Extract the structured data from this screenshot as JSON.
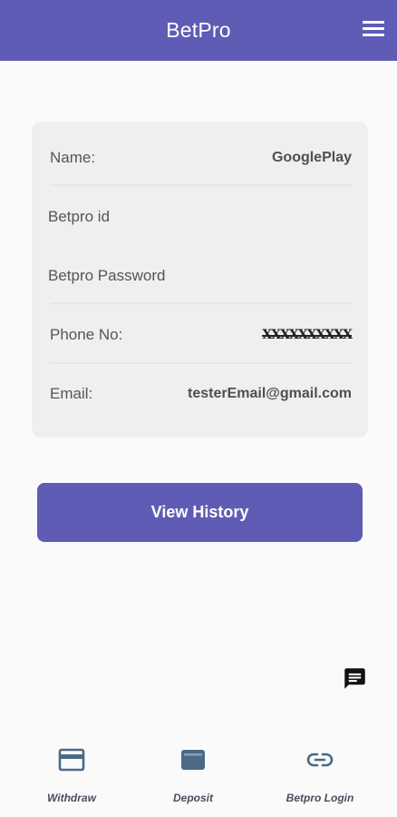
{
  "header": {
    "title": "BetPro",
    "menu_icon": "hamburger-menu-icon"
  },
  "profile": {
    "name_label": "Name:",
    "name_value": "GooglePlay",
    "betpro_id_label": "Betpro id",
    "betpro_password_label": "Betpro Password",
    "phone_label": "Phone No:",
    "phone_value": "XXXXXXXXXX",
    "email_label": "Email:",
    "email_value": "testerEmail@gmail.com"
  },
  "actions": {
    "view_history_label": "View History"
  },
  "chat": {
    "icon": "chat-message-icon"
  },
  "bottom_nav": {
    "items": [
      {
        "label": "Withdraw",
        "icon": "credit-card-icon"
      },
      {
        "label": "Deposit",
        "icon": "wallet-icon"
      },
      {
        "label": "Betpro Login",
        "icon": "link-icon"
      }
    ]
  },
  "colors": {
    "primary": "#5f5cb5",
    "background": "#fafafa",
    "card": "#efefef",
    "nav_icon": "#4a6a86"
  }
}
